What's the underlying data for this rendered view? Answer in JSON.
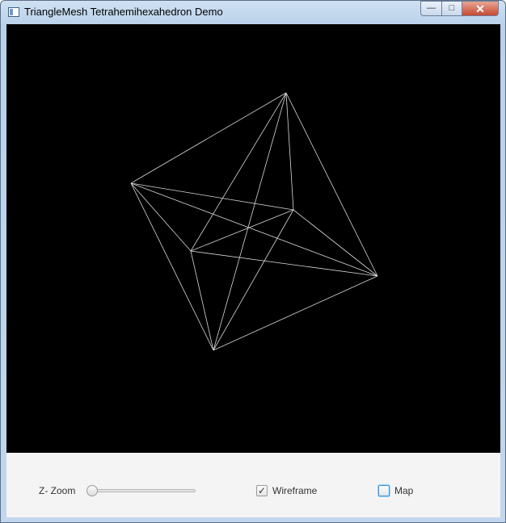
{
  "window": {
    "title": "TriangleMesh Tetrahemihexahedron Demo",
    "controls": {
      "minimize": "—",
      "maximize": "□",
      "close": "✕"
    }
  },
  "controls": {
    "zoom_label": "Z- Zoom",
    "zoom_value": 0,
    "wireframe_label": "Wireframe",
    "wireframe_checked": true,
    "map_label": "Map",
    "map_checked": false
  },
  "colors": {
    "viewport_background": "#000000",
    "wire": "#d8d8d8"
  }
}
